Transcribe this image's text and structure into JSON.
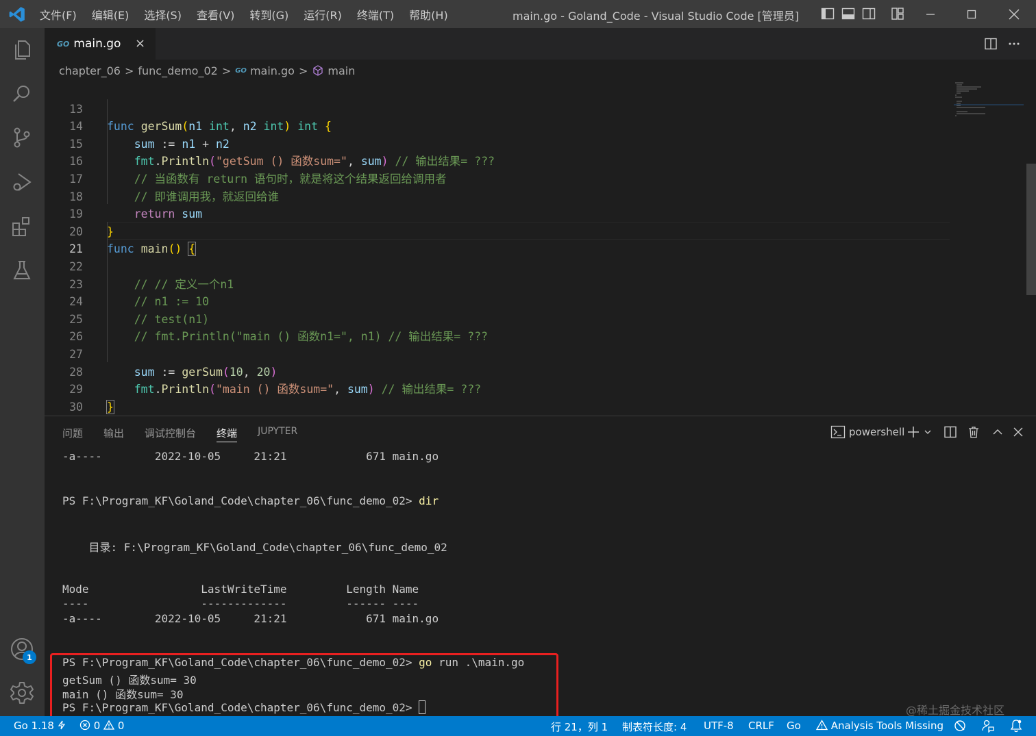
{
  "window": {
    "title": "main.go - Goland_Code - Visual Studio Code [管理员]",
    "menu": [
      "文件(F)",
      "编辑(E)",
      "选择(S)",
      "查看(V)",
      "转到(G)",
      "运行(R)",
      "终端(T)",
      "帮助(H)"
    ]
  },
  "tab": {
    "icon": "go-file-icon",
    "label": "main.go",
    "close": "×"
  },
  "breadcrumb": {
    "items": [
      "chapter_06",
      "func_demo_02",
      "main.go",
      "main"
    ],
    "sep": ">"
  },
  "editor": {
    "active_line": "21",
    "lines": [
      {
        "n": "13"
      },
      {
        "n": "14"
      },
      {
        "n": "15"
      },
      {
        "n": "16"
      },
      {
        "n": "17"
      },
      {
        "n": "18"
      },
      {
        "n": "19"
      },
      {
        "n": "20"
      },
      {
        "n": "21"
      },
      {
        "n": "22"
      },
      {
        "n": "23"
      },
      {
        "n": "24"
      },
      {
        "n": "25"
      },
      {
        "n": "26"
      },
      {
        "n": "27"
      },
      {
        "n": "28"
      },
      {
        "n": "29"
      },
      {
        "n": "30"
      }
    ],
    "tokens": {
      "l13": [
        "func",
        "gerSum",
        "(",
        "n1",
        "int",
        ",",
        "n2",
        "int",
        ")",
        "int",
        "{"
      ],
      "l14": [
        "sum",
        ":=",
        "n1",
        "+",
        "n2"
      ],
      "l15": [
        "fmt",
        ".",
        "Println",
        "(",
        "\"getSum () 函数sum=\"",
        ", ",
        "sum",
        ")",
        "// 输出结果= ???"
      ],
      "l16": [
        "// 当函数有 return 语句时，就是将这个结果返回给调用者"
      ],
      "l17": [
        "// 即谁调用我，就返回给谁"
      ],
      "l18": [
        "return",
        "sum"
      ],
      "l19": [
        "}"
      ],
      "l20": [
        "func",
        "main",
        "()",
        "{"
      ],
      "l22": [
        "// // 定义一个n1"
      ],
      "l23": [
        "// n1 := 10"
      ],
      "l24": [
        "// test(n1)"
      ],
      "l25": [
        "// fmt.Println(\"main () 函数n1=\", n1) // 输出结果= ???"
      ],
      "l27": [
        "sum",
        ":=",
        "gerSum",
        "(",
        "10",
        ", ",
        "20",
        ")"
      ],
      "l28": [
        "fmt",
        ".",
        "Println",
        "(",
        "\"main () 函数sum=\"",
        ", ",
        "sum",
        ")",
        "// 输出结果= ???"
      ],
      "l29": [
        "}"
      ]
    }
  },
  "panel": {
    "tabs": [
      "问题",
      "输出",
      "调试控制台",
      "终端",
      "JUPYTER"
    ],
    "active_tab": "终端",
    "shell": "powershell",
    "terminal_lines": [
      {
        "text": "-a----        2022-10-05     21:21            671 main.go"
      },
      {
        "prompt": "PS F:\\Program_KF\\Goland_Code\\chapter_06\\func_demo_02> ",
        "cmd": "dir"
      },
      {
        "text": "    目录: F:\\Program_KF\\Goland_Code\\chapter_06\\func_demo_02"
      },
      {
        "text": "Mode                 LastWriteTime         Length Name"
      },
      {
        "text": "----                 -------------         ------ ----"
      },
      {
        "text": "-a----        2022-10-05     21:21            671 main.go"
      },
      {
        "prompt": "PS F:\\Program_KF\\Goland_Code\\chapter_06\\func_demo_02> ",
        "cmd": "go",
        "rest": " run .\\main.go"
      },
      {
        "text": "getSum () 函数sum= 30"
      },
      {
        "text": "main () 函数sum= 30"
      },
      {
        "prompt": "PS F:\\Program_KF\\Goland_Code\\chapter_06\\func_demo_02> "
      }
    ],
    "highlight_color": "#e82020"
  },
  "watermark": "@稀土掘金技术社区",
  "accounts_badge": "1",
  "statusbar": {
    "go_version": "Go 1.18",
    "errors": "0",
    "warnings": "0",
    "position": "行 21，列 1",
    "tab_size": "制表符长度: 4",
    "encoding": "UTF-8",
    "eol": "CRLF",
    "language": "Go",
    "analysis": "Analysis Tools Missing"
  },
  "colors": {
    "accent": "#007acc",
    "titlebar": "#3c3c3c",
    "activitybar": "#333333",
    "editor_bg": "#1e1e1e"
  }
}
